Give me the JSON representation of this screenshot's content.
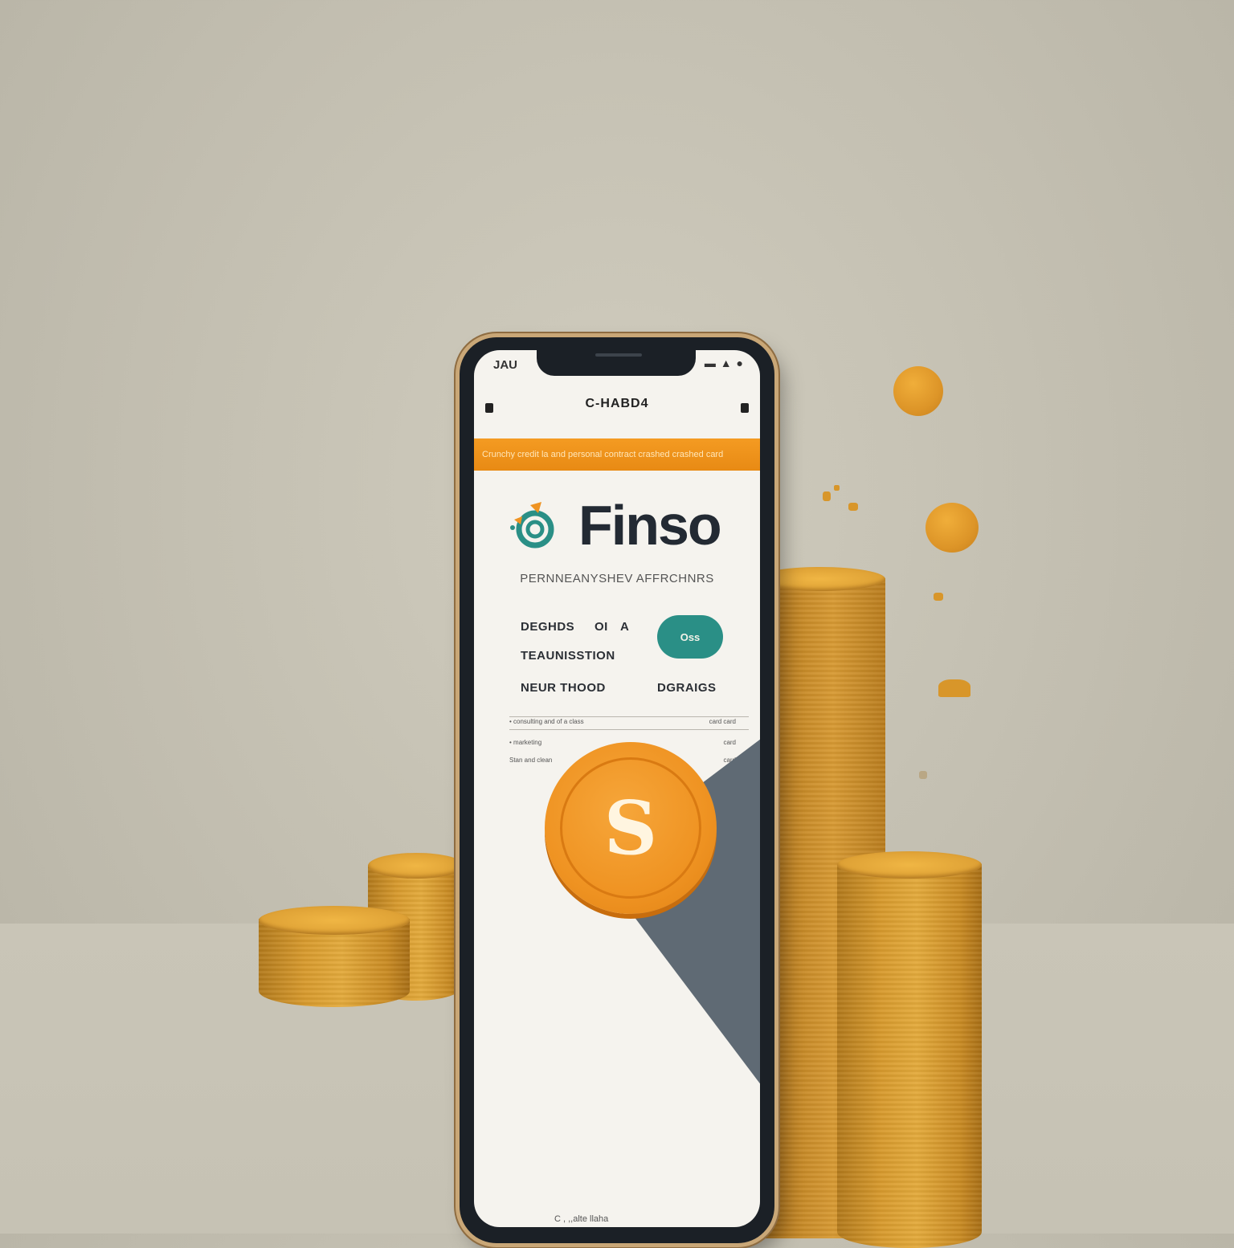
{
  "status": {
    "left": "JAU",
    "right": "▬ ▲ ●"
  },
  "nav": {
    "title": "C-HABD4"
  },
  "banner": {
    "text": "Crunchy credit la and personal contract crashed crashed card"
  },
  "brand": {
    "name": "Finso"
  },
  "tagline": "PERNNEANYSHEV AFFRCHNRS",
  "info": {
    "line1_left": "DEGHDS",
    "line1_mid": "OI",
    "line1_right": "A",
    "line2": "TEAUNISSTION",
    "line3": "NEUR THOOD",
    "button_label": "Oss",
    "side_label": "DGRAIGS"
  },
  "rows": [
    {
      "left": "• consulting and of a class",
      "right": "card card"
    },
    {
      "left": "• marketing",
      "right": "card"
    },
    {
      "left": "Stan and clean",
      "right": "card"
    }
  ],
  "coin_symbol": "S",
  "footer": "C , ,,alte llaha",
  "colors": {
    "accent": "#ef9322",
    "teal": "#2a8f86",
    "brand_text": "#232a33",
    "background": "#c2beb0"
  },
  "icons": [
    "logo-swirl-icon",
    "dollar-coin-icon"
  ]
}
